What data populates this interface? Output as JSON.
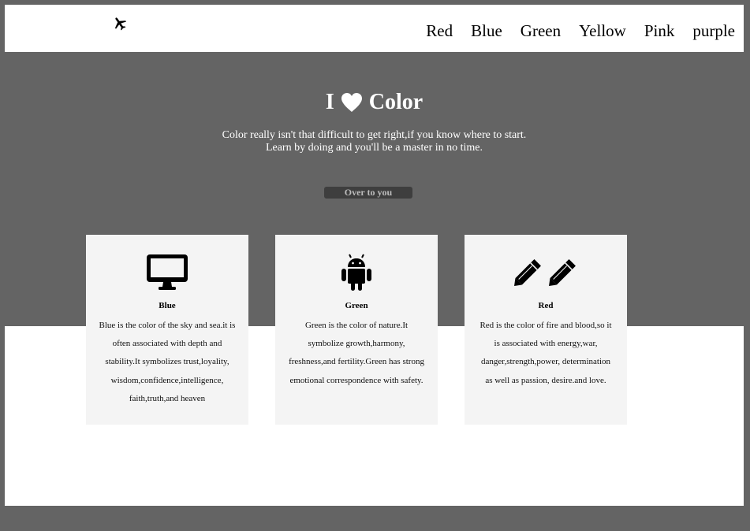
{
  "nav": {
    "logo_icon": "airplane-icon",
    "items": [
      "Red",
      "Blue",
      "Green",
      "Yellow",
      "Pink",
      "purple"
    ]
  },
  "hero": {
    "title_prefix": "I",
    "heart_icon": "heart-icon",
    "title_suffix": "Color",
    "subtitle_line1": "Color really isn't that difficult to get right,if you know where to start.",
    "subtitle_line2": "Learn by doing and you'll be a master in no time.",
    "button_label": "Over to you"
  },
  "cards": [
    {
      "icon": "desktop-icon",
      "title": "Blue",
      "text": "Blue is the color of the sky and sea.it is often associated with depth and stability.It symbolizes trust,loyality, wisdom,confidence,intelligence, faith,truth,and heaven"
    },
    {
      "icon": "android-icon",
      "title": "Green",
      "text": "Green is the color of nature.It symbolize growth,harmony, freshness,and fertility.Green has strong emotional correspondence with safety."
    },
    {
      "icon": "pencils-icon",
      "title": "Red",
      "text": "Red is the color of fire and blood,so it is associated with energy,war, danger,strength,power, determination as well as passion, desire.and love."
    }
  ],
  "colors": {
    "background": "#646464",
    "card": "#f4f4f4",
    "button": "#3e3e3e"
  }
}
